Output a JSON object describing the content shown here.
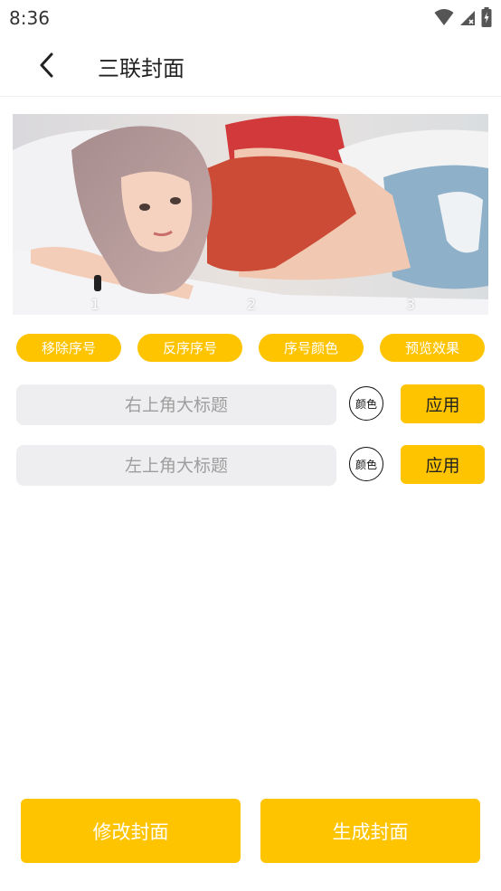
{
  "status": {
    "time": "8:36"
  },
  "header": {
    "title": "三联封面"
  },
  "preview": {
    "panels": [
      "1",
      "2",
      "3"
    ]
  },
  "actions": [
    "移除序号",
    "反序序号",
    "序号颜色",
    "预览效果"
  ],
  "title_rows": [
    {
      "placeholder": "右上角大标题",
      "value": "",
      "color_label": "颜色",
      "apply_label": "应用"
    },
    {
      "placeholder": "左上角大标题",
      "value": "",
      "color_label": "颜色",
      "apply_label": "应用"
    }
  ],
  "footer": {
    "modify_label": "修改封面",
    "generate_label": "生成封面"
  },
  "colors": {
    "accent": "#ffc400",
    "field_bg": "#eeeef0"
  }
}
